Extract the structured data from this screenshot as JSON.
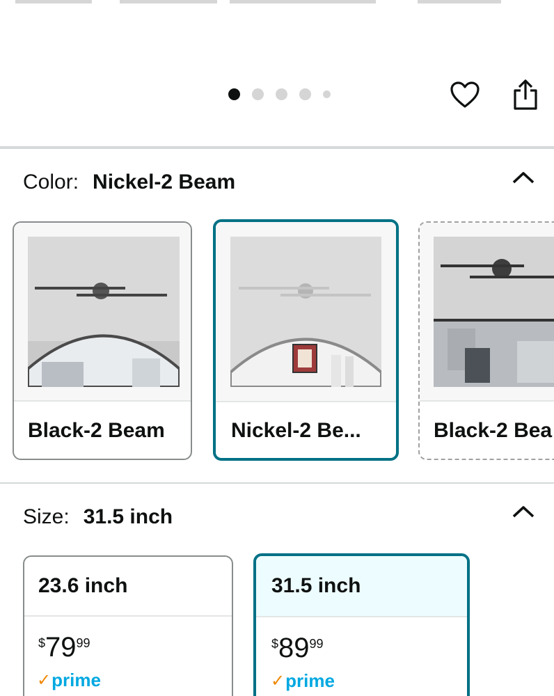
{
  "gallery": {
    "dot_count": 5,
    "active_dot": 1
  },
  "actions": {
    "favorite_icon": "heart-icon",
    "share_icon": "share-icon"
  },
  "color_section": {
    "label": "Color:",
    "selected_value": "Nickel-2 Beam",
    "expanded": true,
    "options": [
      {
        "name": "Black-2 Beam",
        "selected": false,
        "available": true
      },
      {
        "name": "Nickel-2 Be...",
        "selected": true,
        "available": true
      },
      {
        "name": "Black-2 Bea",
        "selected": false,
        "available": false
      }
    ]
  },
  "size_section": {
    "label": "Size:",
    "selected_value": "31.5 inch",
    "expanded": true,
    "options": [
      {
        "name": "23.6 inch",
        "currency": "$",
        "price_whole": "79",
        "price_fraction": "99",
        "badge": "prime",
        "selected": false
      },
      {
        "name": "31.5 inch",
        "currency": "$",
        "price_whole": "89",
        "price_fraction": "99",
        "badge": "prime",
        "selected": true
      }
    ]
  },
  "colors": {
    "accent_teal": "#007185",
    "selected_bg": "#edfdff",
    "prime_blue": "#00a8e1",
    "prime_check": "#f08804"
  }
}
